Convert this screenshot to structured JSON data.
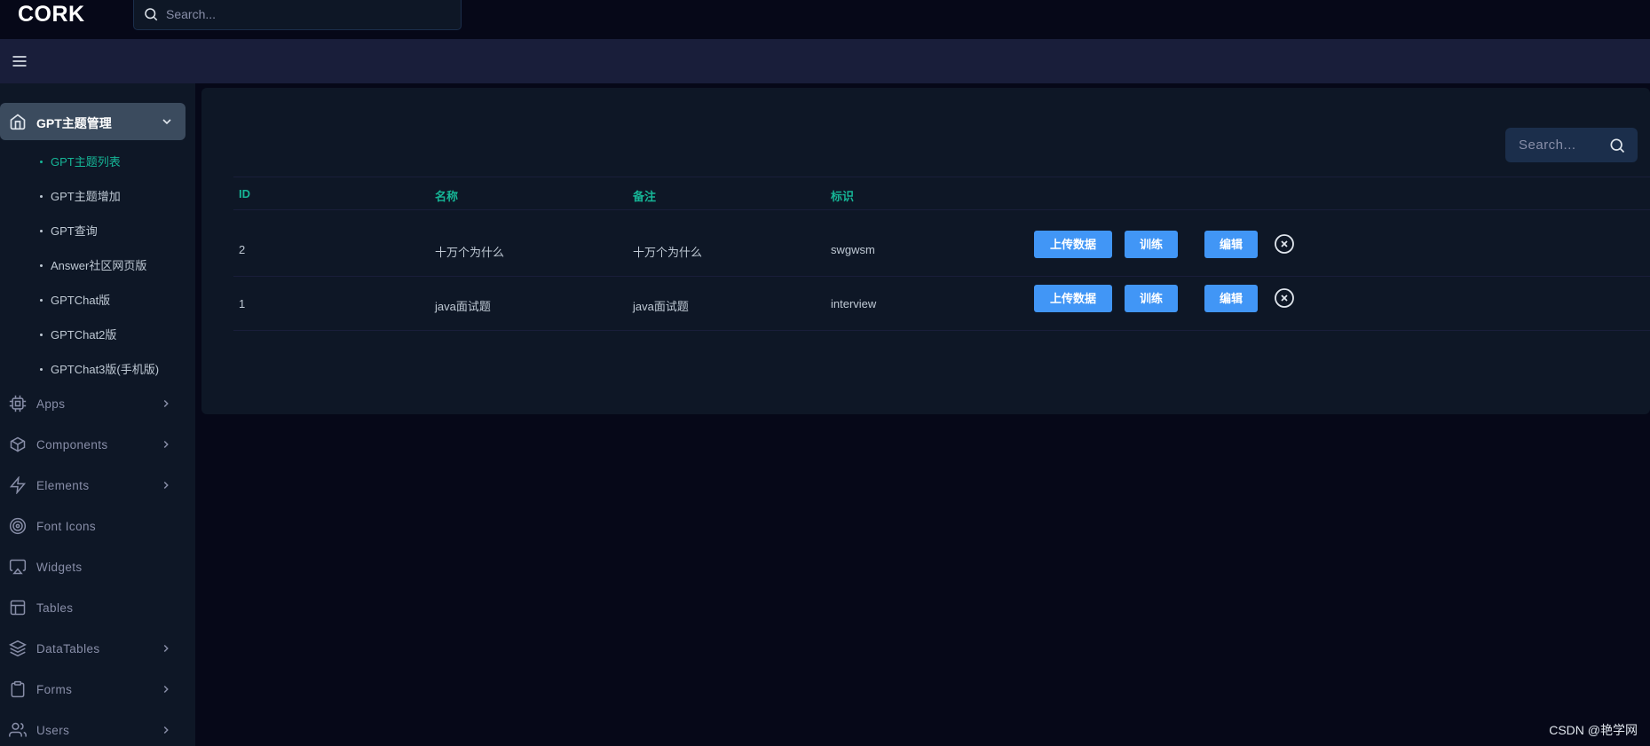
{
  "header": {
    "logo": "CORK",
    "search_placeholder": "Search..."
  },
  "sidebar": {
    "active_section": "GPT主题管理",
    "sub_items": [
      {
        "label": "GPT主题列表",
        "active": true
      },
      {
        "label": "GPT主题增加",
        "active": false
      },
      {
        "label": "GPT查询",
        "active": false
      },
      {
        "label": "Answer社区网页版",
        "active": false
      },
      {
        "label": "GPTChat版",
        "active": false
      },
      {
        "label": "GPTChat2版",
        "active": false
      },
      {
        "label": "GPTChat3版(手机版)",
        "active": false
      }
    ],
    "menu": [
      {
        "label": "Apps",
        "icon": "cpu-icon",
        "has_chevron": true
      },
      {
        "label": "Components",
        "icon": "box-icon",
        "has_chevron": true
      },
      {
        "label": "Elements",
        "icon": "zap-icon",
        "has_chevron": true
      },
      {
        "label": "Font Icons",
        "icon": "target-icon",
        "has_chevron": false
      },
      {
        "label": "Widgets",
        "icon": "airplay-icon",
        "has_chevron": false
      },
      {
        "label": "Tables",
        "icon": "layout-icon",
        "has_chevron": false
      },
      {
        "label": "DataTables",
        "icon": "layers-icon",
        "has_chevron": true
      },
      {
        "label": "Forms",
        "icon": "clipboard-icon",
        "has_chevron": true
      },
      {
        "label": "Users",
        "icon": "users-icon",
        "has_chevron": true
      }
    ]
  },
  "table": {
    "search_placeholder": "Search...",
    "columns": [
      "ID",
      "名称",
      "备注",
      "标识"
    ],
    "rows": [
      {
        "id": "2",
        "name": "十万个为什么",
        "remark": "十万个为什么",
        "code": "swgwsm"
      },
      {
        "id": "1",
        "name": "java面试题",
        "remark": "java面试题",
        "code": "interview"
      }
    ],
    "actions": {
      "upload": "上传数据",
      "train": "训练",
      "edit": "编辑"
    }
  },
  "watermark": "CSDN @艳学网",
  "colors": {
    "background": "#060818",
    "panel": "#0e1726",
    "accent": "#16b596",
    "button": "#4196f6"
  }
}
